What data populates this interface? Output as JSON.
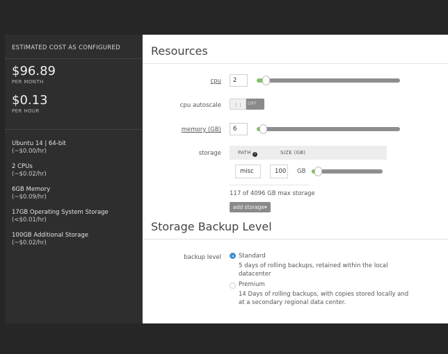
{
  "summary": {
    "title": "ESTIMATED COST AS CONFIGURED",
    "monthly_price": "$96.89",
    "monthly_unit": "PER MONTH",
    "hourly_price": "$0.13",
    "hourly_unit": "PER HOUR",
    "items": [
      {
        "label": "Ubuntu 14 | 64-bit",
        "cost": "(~$0.00/hr)"
      },
      {
        "label": "2 CPUs",
        "cost": "(~$0.02/hr)"
      },
      {
        "label": "6GB Memory",
        "cost": "(~$0.09/hr)"
      },
      {
        "label": "17GB Operating System Storage",
        "cost": "(<$0.01/hr)"
      },
      {
        "label": "100GB Additional Storage",
        "cost": "(~$0.02/hr)"
      }
    ]
  },
  "resources": {
    "title": "Resources",
    "cpu": {
      "label": "cpu",
      "value": "2",
      "level": 0.03
    },
    "autoscale": {
      "label": "cpu autoscale",
      "state": "OFF"
    },
    "memory": {
      "label": "memory (GB)",
      "value": "6",
      "level": 0.01
    },
    "storage": {
      "label": "storage",
      "col_path": "PATH",
      "col_size": "SIZE (GB)",
      "path_value": "misc",
      "size_value": "100",
      "unit": "GB",
      "level": 0.02,
      "max_text": "117 of 4096 GB max storage",
      "add_button": "add storage▾"
    }
  },
  "backup": {
    "title": "Storage Backup Level",
    "label": "backup level",
    "options": [
      {
        "title": "Standard",
        "desc": "5 days of rolling backups, retained within the local datacenter",
        "selected": true
      },
      {
        "title": "Premium",
        "desc": "14 Days of rolling backups, with copies stored locally and at a secondary regional data center.",
        "selected": false
      }
    ]
  },
  "colors": {
    "accent_green": "#7fc26b",
    "radio_blue": "#3d8fd3"
  }
}
